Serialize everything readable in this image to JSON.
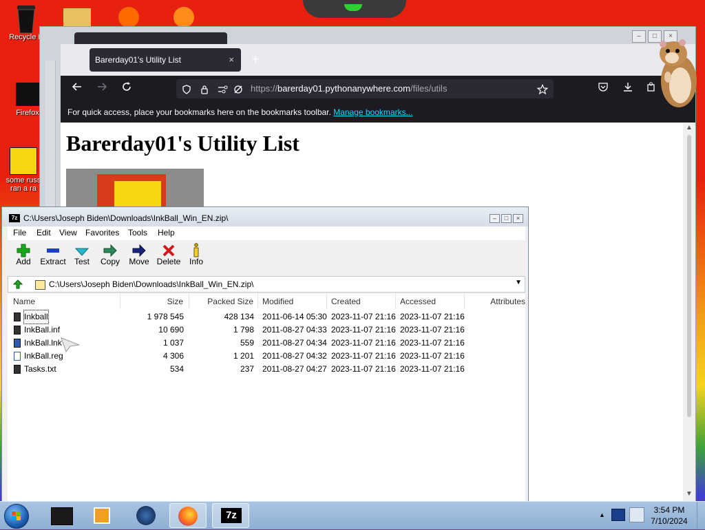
{
  "desktop": {
    "icons": [
      {
        "label": "Recycle B"
      },
      {
        "label": "Firefox"
      },
      {
        "label": "some russ\nran a ra"
      }
    ]
  },
  "browser": {
    "tab_title": "Barerday01's Utility List",
    "tab_close": "×",
    "new_tab": "+",
    "url_prefix": "https://",
    "url_domain": "barerday01.pythonanywhere.com",
    "url_path": "/files/utils",
    "bookmarks_text": "For quick access, place your bookmarks here on the bookmarks toolbar.",
    "bookmarks_link": "Manage bookmarks...",
    "page_heading": "Barerday01's Utility List"
  },
  "sevenzip": {
    "app_icon_text": "7z",
    "window_title": "C:\\Users\\Joseph Biden\\Downloads\\InkBall_Win_EN.zip\\",
    "menu": [
      "File",
      "Edit",
      "View",
      "Favorites",
      "Tools",
      "Help"
    ],
    "toolbar": [
      {
        "label": "Add",
        "icon": "plus-icon",
        "color": "#19a819"
      },
      {
        "label": "Extract",
        "icon": "minus-icon",
        "color": "#1e3fbf"
      },
      {
        "label": "Test",
        "icon": "check-icon",
        "color": "#27b6c9"
      },
      {
        "label": "Copy",
        "icon": "copy-arrow-icon",
        "color": "#2a8a5a"
      },
      {
        "label": "Move",
        "icon": "move-arrow-icon",
        "color": "#1a237e"
      },
      {
        "label": "Delete",
        "icon": "delete-x-icon",
        "color": "#d21919"
      },
      {
        "label": "Info",
        "icon": "info-icon",
        "color": "#c9a400"
      }
    ],
    "address_path": "C:\\Users\\Joseph Biden\\Downloads\\InkBall_Win_EN.zip\\",
    "columns": [
      "Name",
      "Size",
      "Packed Size",
      "Modified",
      "Created",
      "Accessed",
      "Attributes"
    ],
    "files": [
      {
        "name": "Inkball",
        "size": "1 978 545",
        "packed": "428 134",
        "modified": "2011-06-14 05:30",
        "created": "2023-11-07 21:16",
        "accessed": "2023-11-07 21:16",
        "icon": "folder-icon"
      },
      {
        "name": "InkBall.inf",
        "size": "10 690",
        "packed": "1 798",
        "modified": "2011-08-27 04:33",
        "created": "2023-11-07 21:16",
        "accessed": "2023-11-07 21:16",
        "icon": "inf-file-icon"
      },
      {
        "name": "InkBall.lnk",
        "size": "1 037",
        "packed": "559",
        "modified": "2011-08-27 04:34",
        "created": "2023-11-07 21:16",
        "accessed": "2023-11-07 21:16",
        "icon": "shortcut-file-icon"
      },
      {
        "name": "InkBall.reg",
        "size": "4 306",
        "packed": "1 201",
        "modified": "2011-08-27 04:32",
        "created": "2023-11-07 21:16",
        "accessed": "2023-11-07 21:16",
        "icon": "reg-file-icon"
      },
      {
        "name": "Tasks.txt",
        "size": "534",
        "packed": "237",
        "modified": "2011-08-27 04:27",
        "created": "2023-11-07 21:16",
        "accessed": "2023-11-07 21:16",
        "icon": "text-file-icon"
      }
    ]
  },
  "taskbar": {
    "time": "3:54 PM",
    "date": "7/10/2024",
    "sevenzip_label": "7z"
  }
}
